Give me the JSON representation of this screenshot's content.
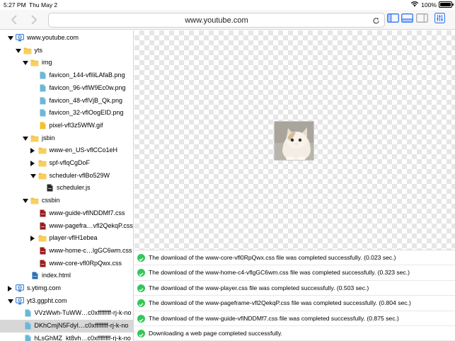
{
  "status_bar": {
    "time": "5:27 PM",
    "date": "Thu May 2",
    "battery": "100%",
    "battery_level": 1.0
  },
  "toolbar": {
    "url": "www.youtube.com"
  },
  "tree": [
    {
      "label": "www.youtube.com",
      "depth": 0,
      "expander": "down",
      "icon": "site",
      "selected": false
    },
    {
      "label": "yts",
      "depth": 1,
      "expander": "down",
      "icon": "folder",
      "selected": false
    },
    {
      "label": "img",
      "depth": 2,
      "expander": "down",
      "icon": "folder",
      "selected": false
    },
    {
      "label": "favicon_144-vflIiLAfaB.png",
      "depth": 3,
      "expander": "none",
      "icon": "image",
      "selected": false
    },
    {
      "label": "favicon_96-vflW9Ec0w.png",
      "depth": 3,
      "expander": "none",
      "icon": "image",
      "selected": false
    },
    {
      "label": "favicon_48-vflVjB_Qk.png",
      "depth": 3,
      "expander": "none",
      "icon": "image",
      "selected": false
    },
    {
      "label": "favicon_32-vflOogEID.png",
      "depth": 3,
      "expander": "none",
      "icon": "image",
      "selected": false
    },
    {
      "label": "pixel-vfl3z5WfW.gif",
      "depth": 3,
      "expander": "none",
      "icon": "gif",
      "selected": false
    },
    {
      "label": "jsbin",
      "depth": 2,
      "expander": "down",
      "icon": "folder",
      "selected": false
    },
    {
      "label": "www-en_US-vflCCo1eH",
      "depth": 3,
      "expander": "right",
      "icon": "folder",
      "selected": false
    },
    {
      "label": "spf-vflqCgDoF",
      "depth": 3,
      "expander": "right",
      "icon": "folder",
      "selected": false
    },
    {
      "label": "scheduler-vflBo529W",
      "depth": 3,
      "expander": "down",
      "icon": "folder",
      "selected": false
    },
    {
      "label": "scheduler.js",
      "depth": 4,
      "expander": "none",
      "icon": "js",
      "selected": false
    },
    {
      "label": "cssbin",
      "depth": 2,
      "expander": "down",
      "icon": "folder",
      "selected": false
    },
    {
      "label": "www-guide-vflNDDMf7.css",
      "depth": 3,
      "expander": "none",
      "icon": "css",
      "selected": false
    },
    {
      "label": "www-pagefra…vfl2QekqP.css",
      "depth": 3,
      "expander": "none",
      "icon": "css",
      "selected": false
    },
    {
      "label": "player-vflH1ebea",
      "depth": 3,
      "expander": "right",
      "icon": "folder",
      "selected": false
    },
    {
      "label": "www-home-c…lgGC6wm.css",
      "depth": 3,
      "expander": "none",
      "icon": "css",
      "selected": false
    },
    {
      "label": "www-core-vfl0RpQwx.css",
      "depth": 3,
      "expander": "none",
      "icon": "css",
      "selected": false
    },
    {
      "label": "index.html",
      "depth": 2,
      "expander": "none",
      "icon": "html",
      "selected": false
    },
    {
      "label": "s.ytimg.com",
      "depth": 0,
      "expander": "right",
      "icon": "site",
      "selected": false
    },
    {
      "label": "yt3.ggpht.com",
      "depth": 0,
      "expander": "down",
      "icon": "site",
      "selected": false
    },
    {
      "label": "VVzWwh-TuWW…c0xffffffff-rj-k-no",
      "depth": 1,
      "expander": "none",
      "icon": "image",
      "selected": false
    },
    {
      "label": "DKhCmjN5FdyI…c0xffffffff-rj-k-no",
      "depth": 1,
      "expander": "none",
      "icon": "image",
      "selected": true
    },
    {
      "label": "hLsGhMZ_kt8vh…c0xffffffff-rj-k-no",
      "depth": 1,
      "expander": "none",
      "icon": "image",
      "selected": false
    }
  ],
  "log": [
    "The download of the www-core-vfl0RpQwx.css file was completed successfully. (0.023 sec.)",
    "The download of the www-home-c4-vflgGC6wm.css file was completed successfully. (0.323 sec.)",
    "The download of the www-player.css file was completed successfully. (0.503 sec.)",
    "The download of the www-pageframe-vfl2QekqP.css file was completed successfully. (0.804 sec.)",
    "The download of the www-guide-vflNDDMf7.css file was completed successfully. (0.875 sec.)",
    "Downloading a web page completed successfully."
  ],
  "colors": {
    "accent": "#3478f6",
    "folder": "#f5c144",
    "success": "#34c759",
    "css": "#9b1c1c",
    "image": "#6bb8d6",
    "html": "#2a6fb0"
  }
}
